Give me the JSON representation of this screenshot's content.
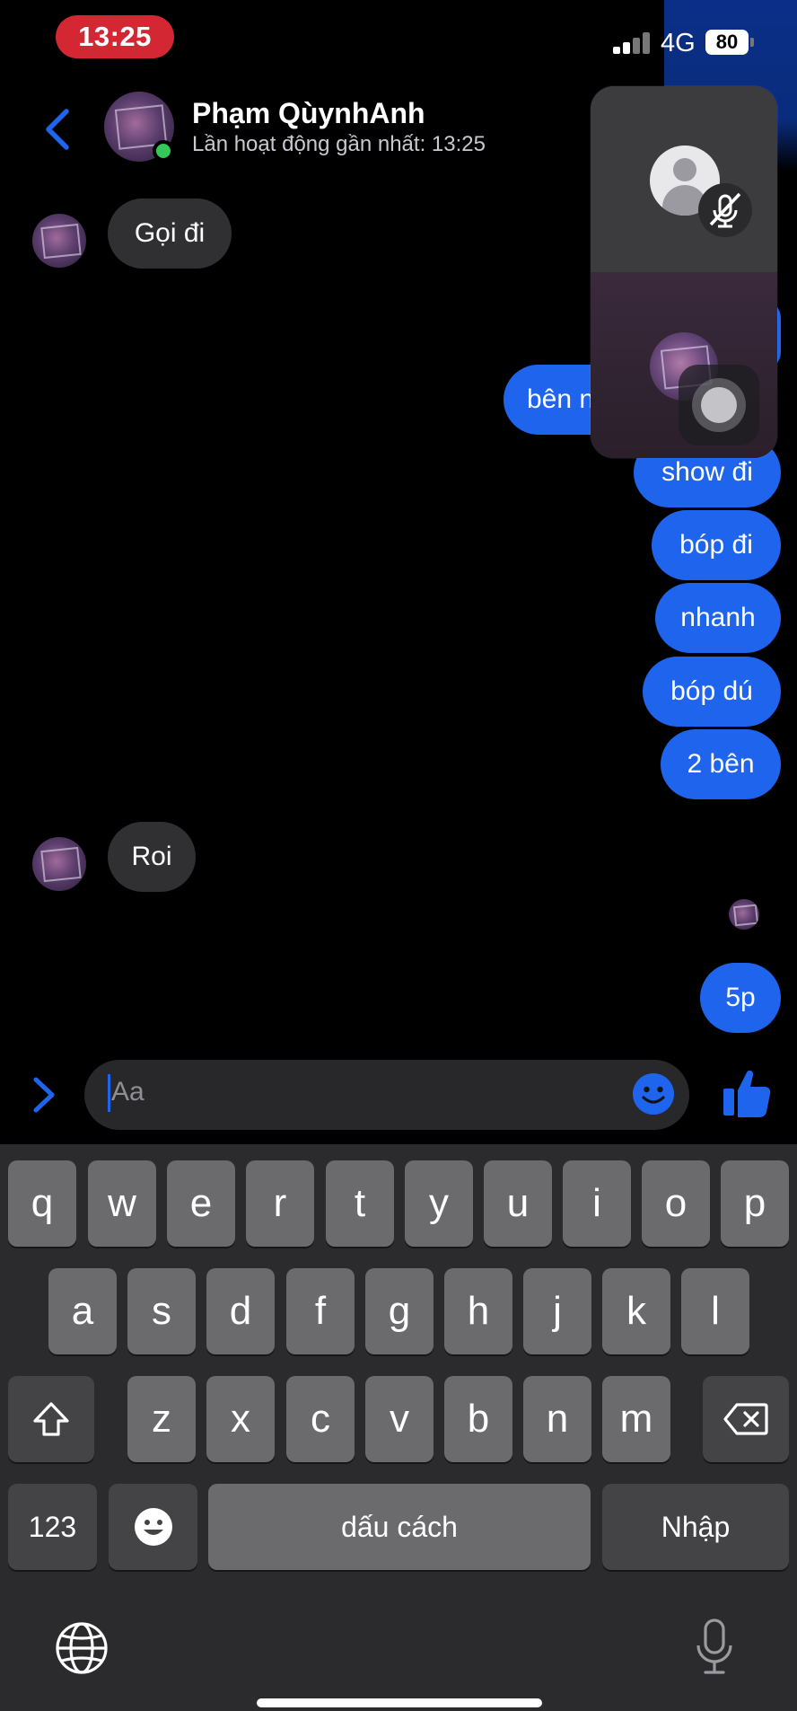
{
  "status_bar": {
    "time": "13:25",
    "network": "4G",
    "battery": "80",
    "time_pill_color": "#d32734"
  },
  "header": {
    "contact_name": "Phạm QùynhAnh",
    "contact_status": "Lần hoạt động gần nhất: 13:25",
    "online": true,
    "online_color": "#35c759"
  },
  "messages": [
    {
      "direction": "in",
      "text": "Gọi đi"
    },
    {
      "direction": "out",
      "text": "bên n"
    },
    {
      "direction": "out",
      "text": "show đi"
    },
    {
      "direction": "out",
      "text": "bóp đi"
    },
    {
      "direction": "out",
      "text": "nhanh"
    },
    {
      "direction": "out",
      "text": "bóp dú"
    },
    {
      "direction": "out",
      "text": "2 bên"
    },
    {
      "direction": "in",
      "text": "Roi"
    },
    {
      "direction": "out",
      "text": "5p"
    }
  ],
  "call_pip": {
    "remote_icon": "person-icon",
    "mute_icon": "mic-muted-icon"
  },
  "composer": {
    "placeholder": "Aa",
    "expand_icon": "chevron-right-icon",
    "emoji_icon": "smile-icon",
    "send_icon": "thumbs-up-icon"
  },
  "keyboard": {
    "row1": [
      "q",
      "w",
      "e",
      "r",
      "t",
      "y",
      "u",
      "i",
      "o",
      "p"
    ],
    "row2": [
      "a",
      "s",
      "d",
      "f",
      "g",
      "h",
      "j",
      "k",
      "l"
    ],
    "row3": [
      "z",
      "x",
      "c",
      "v",
      "b",
      "n",
      "m"
    ],
    "numbers_key": "123",
    "space_key": "dấu cách",
    "return_key": "Nhập",
    "shift_icon": "shift-icon",
    "backspace_icon": "backspace-icon",
    "emoji_icon": "emoji-icon",
    "globe_icon": "globe-icon",
    "dictation_icon": "microphone-icon"
  },
  "colors": {
    "outgoing_bubble": "#1f64ec",
    "incoming_bubble": "#303033",
    "accent": "#1f64ec"
  }
}
